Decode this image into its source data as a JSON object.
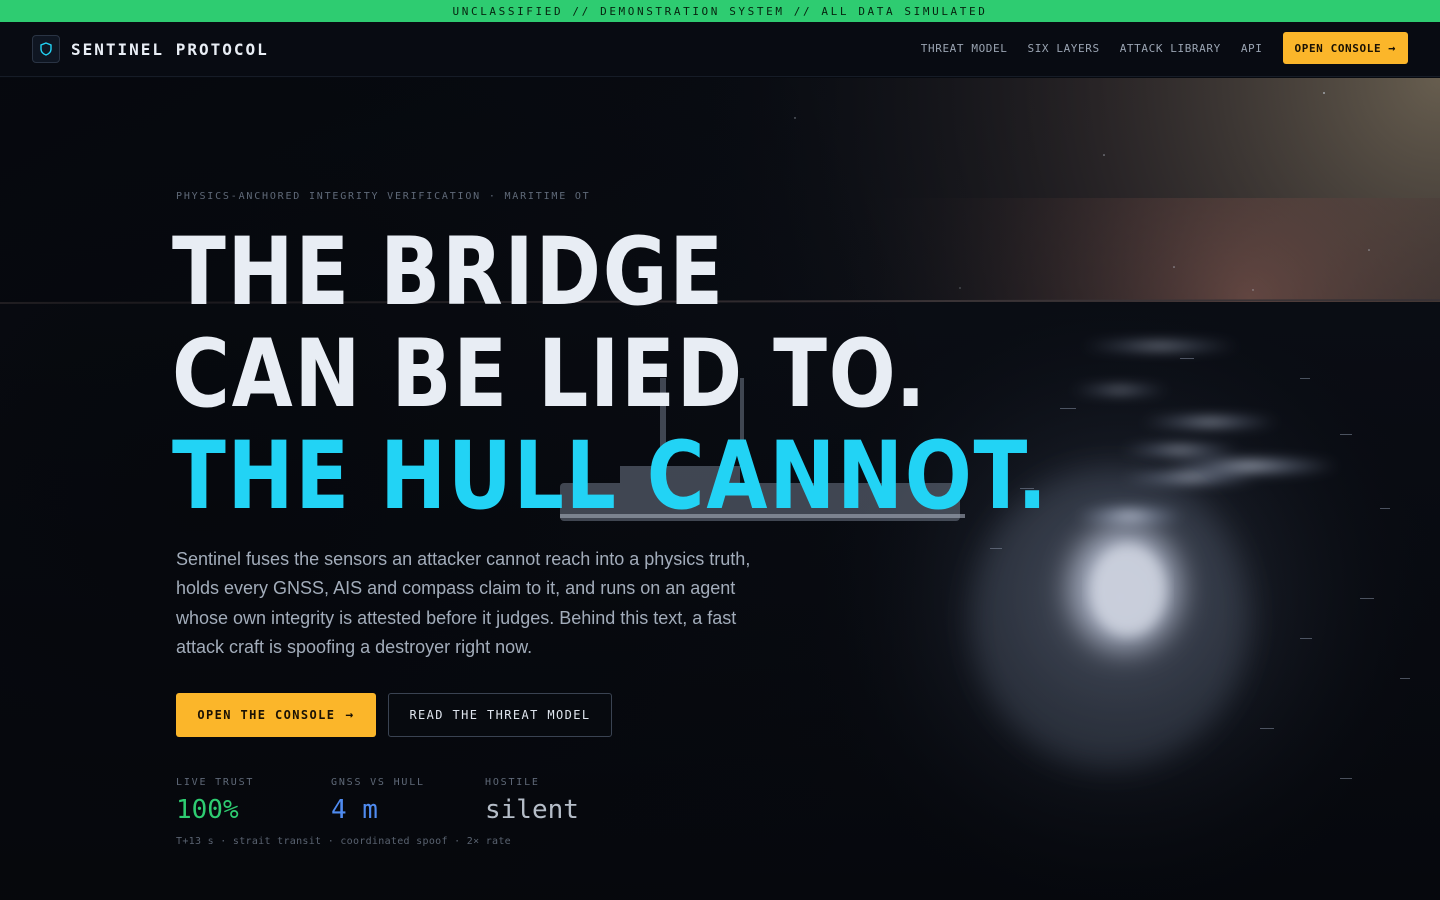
{
  "banner": {
    "text": "UNCLASSIFIED // DEMONSTRATION SYSTEM // ALL DATA SIMULATED"
  },
  "nav": {
    "brand": "SENTINEL PROTOCOL",
    "links": [
      "THREAT MODEL",
      "SIX LAYERS",
      "ATTACK LIBRARY",
      "API"
    ],
    "cta": "OPEN CONSOLE"
  },
  "hero": {
    "eyebrow": "PHYSICS-ANCHORED INTEGRITY VERIFICATION · MARITIME OT",
    "headline": [
      "THE BRIDGE",
      "CAN BE LIED TO.",
      "THE HULL CANNOT."
    ],
    "lede": "Sentinel fuses the sensors an attacker cannot reach into a physics truth, holds every GNSS, AIS and compass claim to it, and runs on an agent whose own integrity is attested before it judges. Behind this text, a fast attack craft is spoofing a destroyer right now.",
    "primary_button": "OPEN THE CONSOLE",
    "secondary_button": "READ THE THREAT MODEL",
    "stats": [
      {
        "label": "LIVE TRUST",
        "value": "100%",
        "color": "#2ecc71"
      },
      {
        "label": "GNSS VS HULL",
        "value": "4 m",
        "color": "#4f8bf0"
      },
      {
        "label": "HOSTILE",
        "value": "silent",
        "color": "#b5bdc8"
      }
    ],
    "footnote": "T+13 s · strait transit · coordinated spoof · 2× rate"
  },
  "colors": {
    "banner": "#2ecc71",
    "accent_cyan": "#22d3f5",
    "cta_amber": "#fbb62a",
    "background": "#070a10"
  },
  "icons": {
    "brand": "shield-icon",
    "arrow": "arrow-right-icon"
  }
}
